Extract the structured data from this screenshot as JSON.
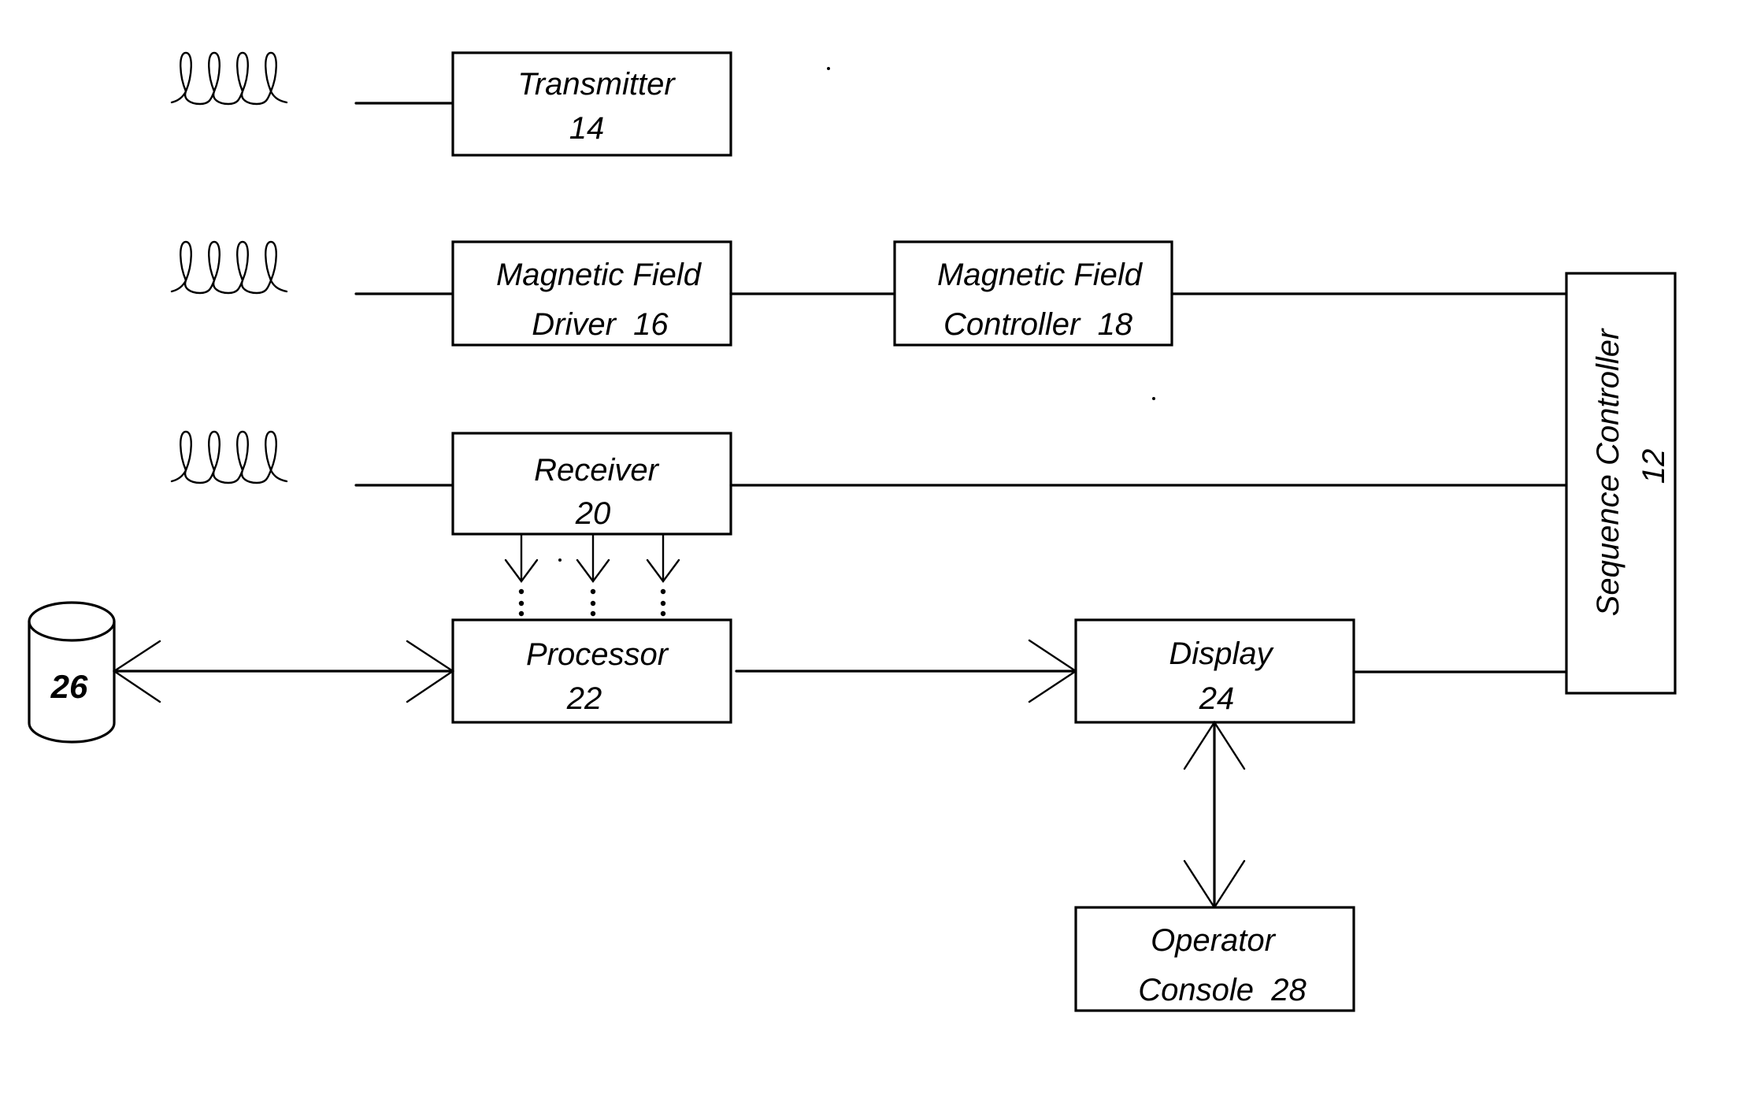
{
  "diagram": {
    "type": "block-diagram",
    "colors": {
      "line": "#000000",
      "background": "#ffffff"
    },
    "coils": [
      {
        "id": "transmit-coil",
        "loops": 4,
        "connects_to": "transmitter"
      },
      {
        "id": "gradient-coil",
        "loops": 4,
        "connects_to": "magnetic-field-driver"
      },
      {
        "id": "receive-coil",
        "loops": 4,
        "connects_to": "receiver"
      }
    ],
    "blocks": {
      "transmitter": {
        "lines": [
          "Transmitter",
          "14"
        ]
      },
      "magnetic_field_driver": {
        "lines": [
          "Magnetic Field",
          "Driver  16"
        ]
      },
      "magnetic_field_controller": {
        "lines": [
          "Magnetic Field",
          "Controller  18"
        ]
      },
      "receiver": {
        "lines": [
          "Receiver",
          "20"
        ]
      },
      "processor": {
        "lines": [
          "Processor",
          "22"
        ]
      },
      "display": {
        "lines": [
          "Display",
          "24"
        ]
      },
      "operator_console": {
        "lines": [
          "Operator",
          "Console  28"
        ]
      },
      "sequence_controller": {
        "lines": [
          "Sequence Controller",
          "12"
        ],
        "orientation": "vertical"
      }
    },
    "storage": {
      "label": "26",
      "shape": "cylinder"
    },
    "connections": [
      {
        "from": "transmit-coil",
        "to": "transmitter",
        "type": "line"
      },
      {
        "from": "gradient-coil",
        "to": "magnetic_field_driver",
        "type": "line"
      },
      {
        "from": "magnetic_field_driver",
        "to": "magnetic_field_controller",
        "type": "line"
      },
      {
        "from": "magnetic_field_controller",
        "to": "sequence_controller",
        "type": "line"
      },
      {
        "from": "receive-coil",
        "to": "receiver",
        "type": "line"
      },
      {
        "from": "receiver",
        "to": "sequence_controller",
        "type": "line"
      },
      {
        "from": "receiver",
        "to": "processor",
        "type": "multi-arrow",
        "count": 3,
        "ellipsis": true
      },
      {
        "from": "storage",
        "to": "processor",
        "type": "bidirectional-arrow"
      },
      {
        "from": "processor",
        "to": "display",
        "type": "arrow"
      },
      {
        "from": "display",
        "to": "sequence_controller",
        "type": "line"
      },
      {
        "from": "display",
        "to": "operator_console",
        "type": "bidirectional-arrow"
      }
    ]
  }
}
